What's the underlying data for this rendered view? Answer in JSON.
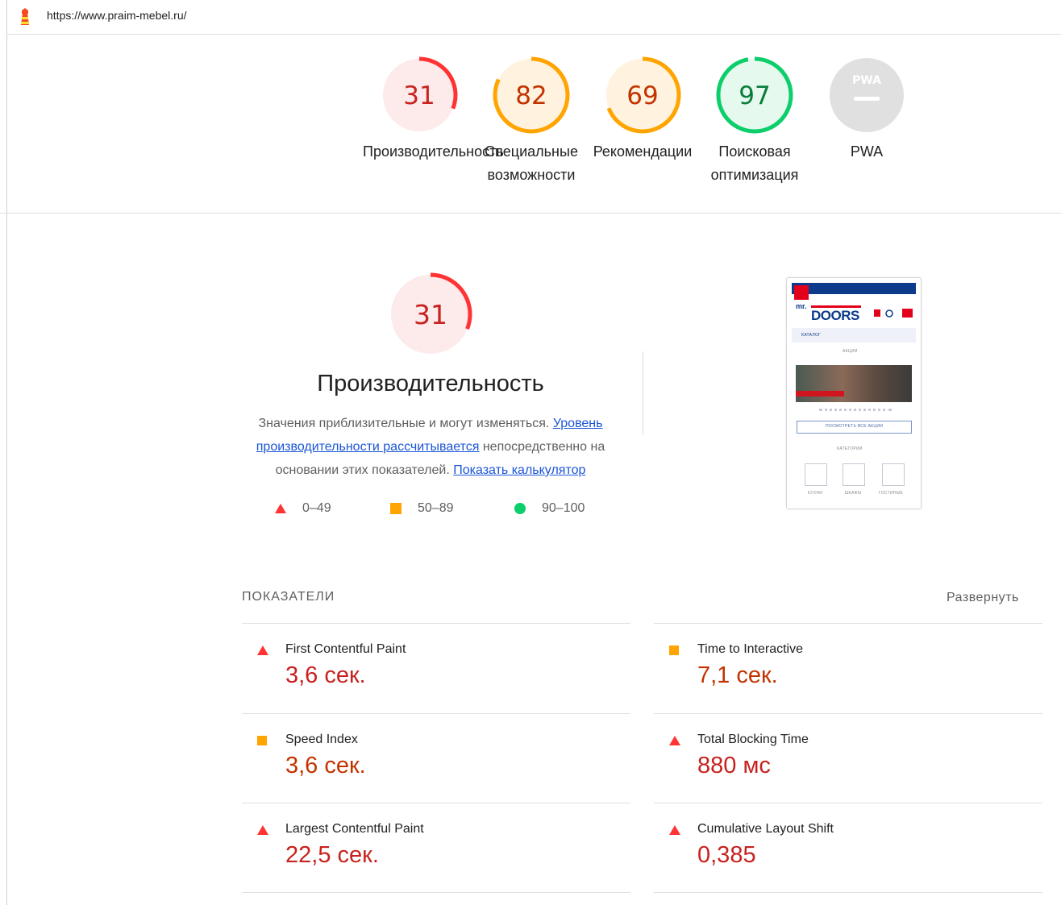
{
  "topbar": {
    "url": "https://www.praim-mebel.ru/"
  },
  "gauges": [
    {
      "score": "31",
      "label": "Производительность",
      "color": "#ff3333",
      "track": "#fdeaea",
      "fraction": 0.31
    },
    {
      "score": "82",
      "label": "Специальные\nвозможности",
      "color": "#ffa400",
      "track": "#fff3e0",
      "fraction": 0.82
    },
    {
      "score": "69",
      "label": "Рекомендации",
      "color": "#ffa400",
      "track": "#fff3e0",
      "fraction": 0.69
    },
    {
      "score": "97",
      "label": "Поисковая\nоптимизация",
      "color": "#0cce6b",
      "track": "#e6f9ef",
      "fraction": 0.97
    },
    {
      "score": "PWA",
      "label": "PWA",
      "color": "#9e9e9e",
      "track": "#e6e6e6",
      "fraction": 0
    }
  ],
  "performance": {
    "score": "31",
    "title": "Производительность",
    "desc_prefix": "Значения приблизительные и могут изменяться.",
    "desc_link1": "Уровень производительности рассчитывается",
    "desc_middle": "непосредственно на основании этих показателей.",
    "desc_link2": "Показать калькулятор"
  },
  "legend": [
    {
      "range": "0–49",
      "icon": "triangle-red-icon"
    },
    {
      "range": "50–89",
      "icon": "square-orange-icon"
    },
    {
      "range": "90–100",
      "icon": "circle-green-icon"
    }
  ],
  "thumbnail": {
    "brand_small": "mr.",
    "brand": "DOORS",
    "catalog": "КАТАЛОГ",
    "promo": "АКЦИИ",
    "view_all": "ПОСМОТРЕТЬ ВСЕ АКЦИИ",
    "categories": "КАТЕГОРИИ",
    "cat1": "КУХНИ",
    "cat2": "ШКАФЫ",
    "cat3": "ГОСТИНЫЕ"
  },
  "metrics": {
    "heading": "ПОКАЗАТЕЛИ",
    "expand": "Развернуть",
    "items": [
      {
        "name": "First Contentful Paint",
        "value": "3,6 сек.",
        "status": "fail"
      },
      {
        "name": "Time to Interactive",
        "value": "7,1 сек.",
        "status": "average"
      },
      {
        "name": "Speed Index",
        "value": "3,6 сек.",
        "status": "average"
      },
      {
        "name": "Total Blocking Time",
        "value": "880 мс",
        "status": "fail"
      },
      {
        "name": "Largest Contentful Paint",
        "value": "22,5 сек.",
        "status": "fail"
      },
      {
        "name": "Cumulative Layout Shift",
        "value": "0,385",
        "status": "fail"
      }
    ]
  }
}
